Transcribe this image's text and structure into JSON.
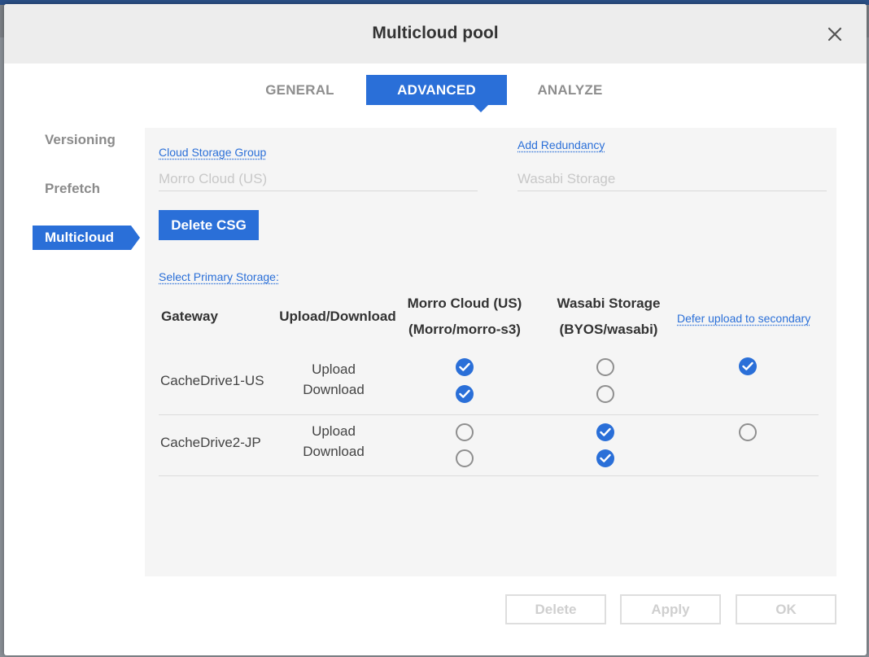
{
  "dialog": {
    "title": "Multicloud pool",
    "close_icon": "close-icon"
  },
  "tabs": [
    {
      "label": "GENERAL",
      "active": false
    },
    {
      "label": "ADVANCED",
      "active": true
    },
    {
      "label": "ANALYZE",
      "active": false
    }
  ],
  "sidebar": {
    "items": [
      {
        "label": "Versioning",
        "active": false
      },
      {
        "label": "Prefetch",
        "active": false
      },
      {
        "label": "Multicloud",
        "active": true
      }
    ]
  },
  "csg": {
    "group_link": "Cloud Storage Group",
    "group_placeholder": "Morro Cloud (US)",
    "redundancy_link": "Add Redundancy",
    "redundancy_placeholder": "Wasabi Storage",
    "delete_label": "Delete CSG",
    "primary_link": "Select Primary Storage:"
  },
  "table": {
    "headers": {
      "gateway": "Gateway",
      "direction": "Upload/Download",
      "storage1_line1": "Morro Cloud (US)",
      "storage1_line2": "(Morro/morro-s3)",
      "storage2_line1": "Wasabi Storage",
      "storage2_line2": "(BYOS/wasabi)",
      "defer_link": "Defer upload to secondary"
    },
    "rows": [
      {
        "gateway": "CacheDrive1-US",
        "upload_label": "Upload",
        "download_label": "Download",
        "upload": {
          "storage1": true,
          "storage2": false
        },
        "download": {
          "storage1": true,
          "storage2": false
        },
        "defer": true
      },
      {
        "gateway": "CacheDrive2-JP",
        "upload_label": "Upload",
        "download_label": "Download",
        "upload": {
          "storage1": false,
          "storage2": true
        },
        "download": {
          "storage1": false,
          "storage2": true
        },
        "defer": false
      }
    ]
  },
  "footer": {
    "delete_label": "Delete",
    "apply_label": "Apply",
    "ok_label": "OK"
  },
  "colors": {
    "accent": "#2a6fd8",
    "header_bg": "#ededed",
    "panel_bg": "#f5f5f5",
    "disabled_text": "#cfcfcf"
  }
}
